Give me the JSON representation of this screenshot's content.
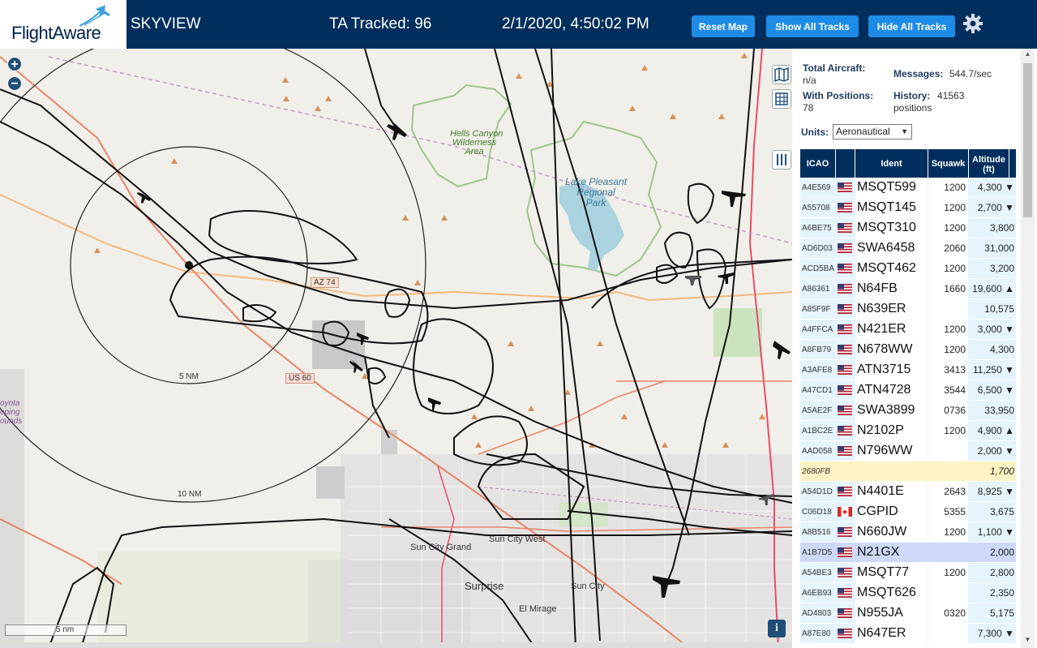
{
  "header": {
    "brand": "FlightAware",
    "app_title": "SKYVIEW",
    "tracked": "TA Tracked: 96",
    "timestamp": "2/1/2020, 4:50:02 PM",
    "buttons": {
      "reset": "Reset Map",
      "show_all": "Show All Tracks",
      "hide_all": "Hide All Tracks"
    },
    "settings_icon": "gear-icon"
  },
  "map": {
    "zoom_in": "+",
    "zoom_out": "−",
    "labels": {
      "hells_canyon": [
        "Hells Canyon",
        "Wilderness",
        "Area"
      ],
      "lake_pleasant": [
        "Lake Pleasant",
        "Regional",
        "Park"
      ],
      "az74": "AZ 74",
      "us60": "US 60",
      "range5": "5 NM",
      "range10": "10 NM",
      "sun_city_grand": "Sun City Grand",
      "sun_city_west": "Sun City West",
      "sun_city": "Sun City",
      "surprise": "Surprise",
      "el_mirage": "El Mirage",
      "coyote": [
        "oyota",
        "oping",
        "ounds"
      ]
    },
    "scale": "5 nm",
    "info": "i",
    "tools": [
      "map-layers-icon",
      "grid-icon",
      "columns-icon"
    ]
  },
  "sidebar": {
    "total_aircraft_label": "Total Aircraft:",
    "total_aircraft_value": "n/a",
    "messages_label": "Messages:",
    "messages_value": "544.7/sec",
    "with_positions_label": "With Positions:",
    "with_positions_value": "78",
    "history_label": "History:",
    "history_value": "41563",
    "history_unit": "positions",
    "units_label": "Units:",
    "units_value": "Aeronautical"
  },
  "table": {
    "headers": [
      "ICAO",
      "Ident",
      "Squawk",
      "Altitude (ft)"
    ],
    "rows": [
      {
        "icao": "A4E569",
        "flag": "us",
        "ident": "MSQT599",
        "squawk": "1200",
        "alt": "4,300 ▼"
      },
      {
        "icao": "A55708",
        "flag": "us",
        "ident": "MSQT145",
        "squawk": "1200",
        "alt": "2,700 ▼"
      },
      {
        "icao": "A6BE75",
        "flag": "us",
        "ident": "MSQT310",
        "squawk": "1200",
        "alt": "3,800"
      },
      {
        "icao": "AD6D03",
        "flag": "us",
        "ident": "SWA6458",
        "squawk": "2060",
        "alt": "31,000"
      },
      {
        "icao": "ACD5BA",
        "flag": "us",
        "ident": "MSQT462",
        "squawk": "1200",
        "alt": "3,200"
      },
      {
        "icao": "A86361",
        "flag": "us",
        "ident": "N64FB",
        "squawk": "1660",
        "alt": "19,600 ▲"
      },
      {
        "icao": "A85F9F",
        "flag": "us",
        "ident": "N639ER",
        "squawk": "",
        "alt": "10,575"
      },
      {
        "icao": "A4FFCA",
        "flag": "us",
        "ident": "N421ER",
        "squawk": "1200",
        "alt": "3,000 ▼"
      },
      {
        "icao": "A8FB79",
        "flag": "us",
        "ident": "N678WW",
        "squawk": "1200",
        "alt": "4,300"
      },
      {
        "icao": "A3AFE8",
        "flag": "us",
        "ident": "ATN3715",
        "squawk": "3413",
        "alt": "11,250 ▼"
      },
      {
        "icao": "A47CD1",
        "flag": "us",
        "ident": "ATN4728",
        "squawk": "3544",
        "alt": "6,500 ▼"
      },
      {
        "icao": "A5AE2F",
        "flag": "us",
        "ident": "SWA3899",
        "squawk": "0736",
        "alt": "33,950"
      },
      {
        "icao": "A1BC2E",
        "flag": "us",
        "ident": "N2102P",
        "squawk": "1200",
        "alt": "4,900 ▲"
      },
      {
        "icao": "AAD058",
        "flag": "us",
        "ident": "N796WW",
        "squawk": "",
        "alt": "2,000 ▼"
      },
      {
        "icao": "2680FB",
        "flag": "",
        "ident": "",
        "squawk": "",
        "alt": "1,700",
        "state": "pending"
      },
      {
        "icao": "A54D1D",
        "flag": "us",
        "ident": "N4401E",
        "squawk": "2643",
        "alt": "8,925 ▼"
      },
      {
        "icao": "C06D18",
        "flag": "ca",
        "ident": "CGPID",
        "squawk": "5355",
        "alt": "3,675"
      },
      {
        "icao": "A8B516",
        "flag": "us",
        "ident": "N660JW",
        "squawk": "1200",
        "alt": "1,100 ▼"
      },
      {
        "icao": "A1B7D5",
        "flag": "us",
        "ident": "N21GX",
        "squawk": "",
        "alt": "2,000",
        "state": "selected"
      },
      {
        "icao": "A54BE3",
        "flag": "us",
        "ident": "MSQT77",
        "squawk": "1200",
        "alt": "2,800"
      },
      {
        "icao": "A6EB93",
        "flag": "us",
        "ident": "MSQT626",
        "squawk": "",
        "alt": "2,350"
      },
      {
        "icao": "AD4803",
        "flag": "us",
        "ident": "N955JA",
        "squawk": "0320",
        "alt": "5,175"
      },
      {
        "icao": "A87E80",
        "flag": "us",
        "ident": "N647ER",
        "squawk": "",
        "alt": "7,300 ▼"
      }
    ]
  }
}
